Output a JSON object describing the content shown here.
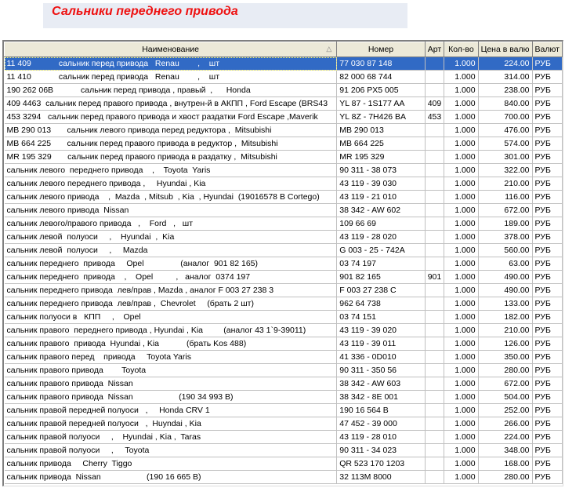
{
  "header": {
    "title": "Сальники переднего привода"
  },
  "grid": {
    "columns": [
      "Наименование",
      "Номер",
      "Арт",
      "Кол-во",
      "Цена в валю",
      "Валют"
    ],
    "selected_row": 0,
    "rows": [
      [
        "11 409            сальник перед привода   Renau        ,    шт",
        "77 030 87 148",
        "",
        "1.000",
        "224.00",
        "РУБ"
      ],
      [
        "11 410            сальник перед привода   Renau        ,    шт",
        "82 000 68 744",
        "",
        "1.000",
        "314.00",
        "РУБ"
      ],
      [
        "190 262 06В            сальник перед привода , правый  ,      Honda",
        "91 206 PX5 005",
        "",
        "1.000",
        "238.00",
        "РУБ"
      ],
      [
        "409 4463  сальник перед правого привода , внутрен-й в АКПП , Ford Escape (BRS43",
        "YL 87 - 1S177 AA",
        "409",
        "1.000",
        "840.00",
        "РУБ"
      ],
      [
        "453 3294   сальник перед правого привода и хвост раздатки Ford Escape ,Maverik",
        "YL 8Z - 7H426 BA",
        "453",
        "1.000",
        "700.00",
        "РУБ"
      ],
      [
        "MB 290 013       сальник левого привода перед редуктора ,  Mitsubishi",
        "MB 290 013",
        "",
        "1.000",
        "476.00",
        "РУБ"
      ],
      [
        "MB 664 225       сальник перед правого привода в редуктор ,  Mitsubishi",
        "MB 664 225",
        "",
        "1.000",
        "574.00",
        "РУБ"
      ],
      [
        "MR 195 329       сальник перед правого привода в раздатку ,  Mitsubishi",
        "MR 195 329",
        "",
        "1.000",
        "301.00",
        "РУБ"
      ],
      [
        "сальник левого  переднего привода    ,    Toyota  Yaris",
        "90 311 - 38 073",
        "",
        "1.000",
        "322.00",
        "РУБ"
      ],
      [
        "сальник левого переднего привода ,     Hyundai , Kia",
        "43 119 - 39 030",
        "",
        "1.000",
        "210.00",
        "РУБ"
      ],
      [
        "сальник левого привода    ,  Mazda  , Mitsub  , Kia  , Hyundai  (19016578 В Cortego)",
        "43 119 - 21 010",
        "",
        "1.000",
        "116.00",
        "РУБ"
      ],
      [
        "сальник левого привода  Nissan",
        "38 342 - AW 602",
        "",
        "1.000",
        "672.00",
        "РУБ"
      ],
      [
        "сальник левого/правого привода   ,    Ford   ,   шт",
        "109 66 69",
        "",
        "1.000",
        "189.00",
        "РУБ"
      ],
      [
        "сальник левой  полуоси     ,    Hyundai  ,  Kia",
        "43 119 - 28 020",
        "",
        "1.000",
        "378.00",
        "РУБ"
      ],
      [
        "сальник левой  полуоси     ,     Mazda",
        "G 003 - 25 - 742A",
        "",
        "1.000",
        "560.00",
        "РУБ"
      ],
      [
        "сальник переднего  привода     Opel                (аналог  901 82 165)",
        "03 74 197",
        "",
        "1.000",
        "63.00",
        "РУБ"
      ],
      [
        "сальник переднего  привода    ,    Opel          ,   аналог  0374 197",
        "901 82 165",
        "901",
        "1.000",
        "490.00",
        "РУБ"
      ],
      [
        "сальник переднего привода  лев/прав , Mazda , аналог F 003 27 238 3",
        "F 003 27 238 C",
        "",
        "1.000",
        "490.00",
        "РУБ"
      ],
      [
        "сальник переднего привода  лев/прав ,  Chevrolet     (брать 2 шт)",
        "962 64 738",
        "",
        "1.000",
        "133.00",
        "РУБ"
      ],
      [
        "сальник полуоси в   КПП     ,    Opel",
        "03 74 151",
        "",
        "1.000",
        "182.00",
        "РУБ"
      ],
      [
        "сальник правого  переднего привода , Hyundai , Kia         (аналог 43 1`9-39011)",
        "43 119 - 39 020",
        "",
        "1.000",
        "210.00",
        "РУБ"
      ],
      [
        "сальник правого  привода  Hyundai , Kia            (брать Kos 488)",
        "43 119 - 39 011",
        "",
        "1.000",
        "126.00",
        "РУБ"
      ],
      [
        "сальник правого перед    привода     Toyota Yaris",
        "41 336 - 0D010",
        "",
        "1.000",
        "350.00",
        "РУБ"
      ],
      [
        "сальник правого привода        Toyota",
        "90 311 - 350 56",
        "",
        "1.000",
        "280.00",
        "РУБ"
      ],
      [
        "сальник правого привода  Nissan",
        "38 342 - AW 603",
        "",
        "1.000",
        "672.00",
        "РУБ"
      ],
      [
        "сальник правого привода  Nissan                    (190 34 993 В)",
        "38 342 - 8E 001",
        "",
        "1.000",
        "504.00",
        "РУБ"
      ],
      [
        "сальник правой передней полуоси   ,     Honda CRV 1",
        "190 16 564 В",
        "",
        "1.000",
        "252.00",
        "РУБ"
      ],
      [
        "сальник правой передней полуоси   ,  Huyndai , Kia",
        "47 452 - 39 000",
        "",
        "1.000",
        "266.00",
        "РУБ"
      ],
      [
        "сальник правой полуоси     ,    Hyundai , Kia ,  Taras",
        "43 119 - 28 010",
        "",
        "1.000",
        "224.00",
        "РУБ"
      ],
      [
        "сальник правой полуоси     ,     Toyota",
        "90 311 - 34 023",
        "",
        "1.000",
        "348.00",
        "РУБ"
      ],
      [
        "сальник привода     Cherry  Tiggo",
        "QR 523 170 1203",
        "",
        "1.000",
        "168.00",
        "РУБ"
      ],
      [
        "сальник привода  Nissan                    (190 16 665 В)",
        "32 113M 8000",
        "",
        "1.000",
        "280.00",
        "РУБ"
      ]
    ]
  },
  "icons": {
    "sort": "sort-ascending-triangle"
  }
}
